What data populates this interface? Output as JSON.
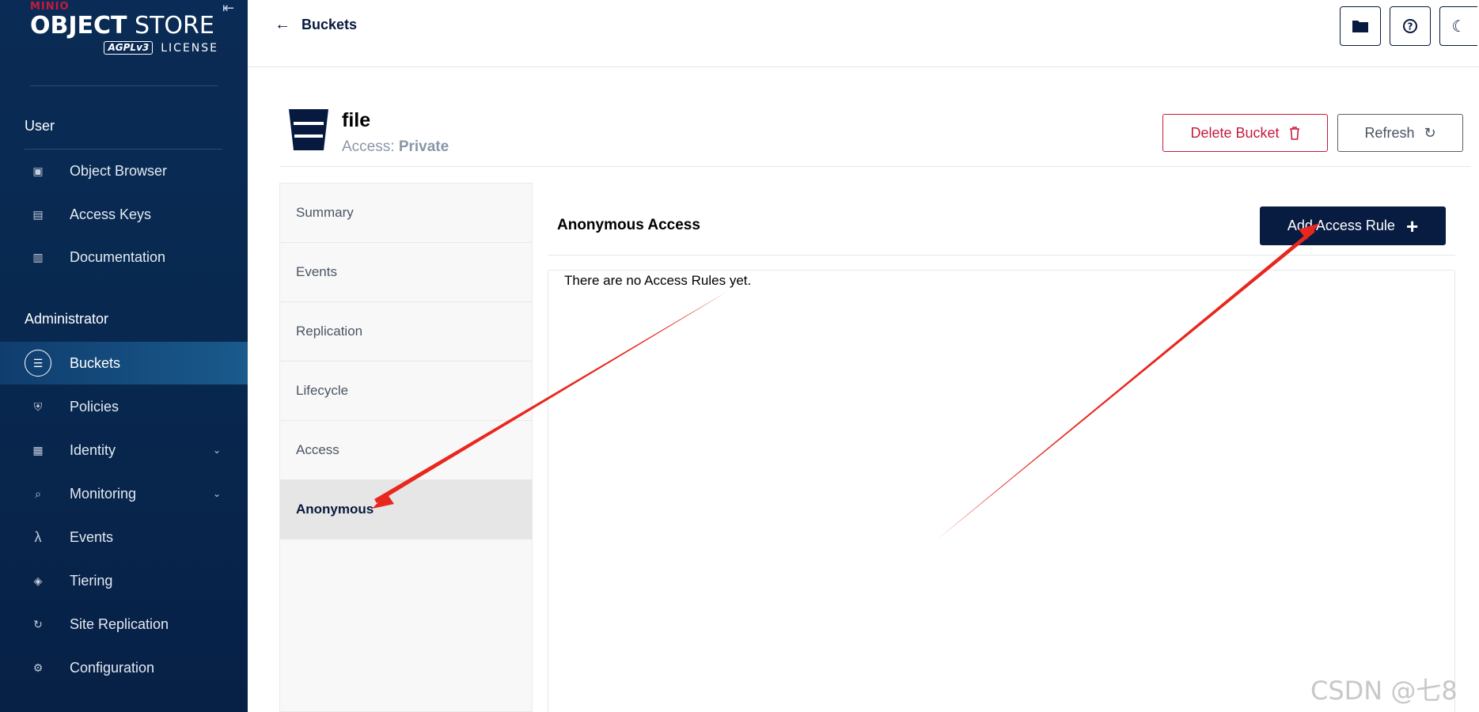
{
  "sidebar": {
    "logo": {
      "brand": "MINIO",
      "product_bold": "OBJECT",
      "product_rest": " STORE",
      "agpl": "AGPLv3",
      "license": "LICENSE"
    },
    "user_section": "User",
    "user_items": [
      {
        "label": "Object Browser",
        "icon": "object-browser-icon"
      },
      {
        "label": "Access Keys",
        "icon": "access-keys-icon"
      },
      {
        "label": "Documentation",
        "icon": "documentation-icon"
      }
    ],
    "admin_section": "Administrator",
    "admin_items": [
      {
        "label": "Buckets",
        "icon": "bucket-icon",
        "active": true
      },
      {
        "label": "Policies",
        "icon": "policies-icon"
      },
      {
        "label": "Identity",
        "icon": "identity-icon",
        "expandable": true
      },
      {
        "label": "Monitoring",
        "icon": "monitoring-icon",
        "expandable": true
      },
      {
        "label": "Events",
        "icon": "lambda-icon"
      },
      {
        "label": "Tiering",
        "icon": "layers-icon"
      },
      {
        "label": "Site Replication",
        "icon": "sync-icon"
      },
      {
        "label": "Configuration",
        "icon": "gear-icon"
      }
    ]
  },
  "topbar": {
    "back_label": "Buckets"
  },
  "bucket": {
    "name": "file",
    "access_label": "Access: ",
    "access_value": "Private",
    "delete_label": "Delete Bucket",
    "refresh_label": "Refresh"
  },
  "tabs": [
    "Summary",
    "Events",
    "Replication",
    "Lifecycle",
    "Access",
    "Anonymous"
  ],
  "active_tab": "Anonymous",
  "content": {
    "title": "Anonymous Access",
    "add_label": "Add Access Rule",
    "empty_message": "There are no Access Rules yet."
  },
  "watermark": "CSDN @七8",
  "colors": {
    "sidebar": "#0a2b55",
    "accent_red": "#c51b3d",
    "primary_dark": "#081c42",
    "annotation_arrow": "#e8271e"
  }
}
